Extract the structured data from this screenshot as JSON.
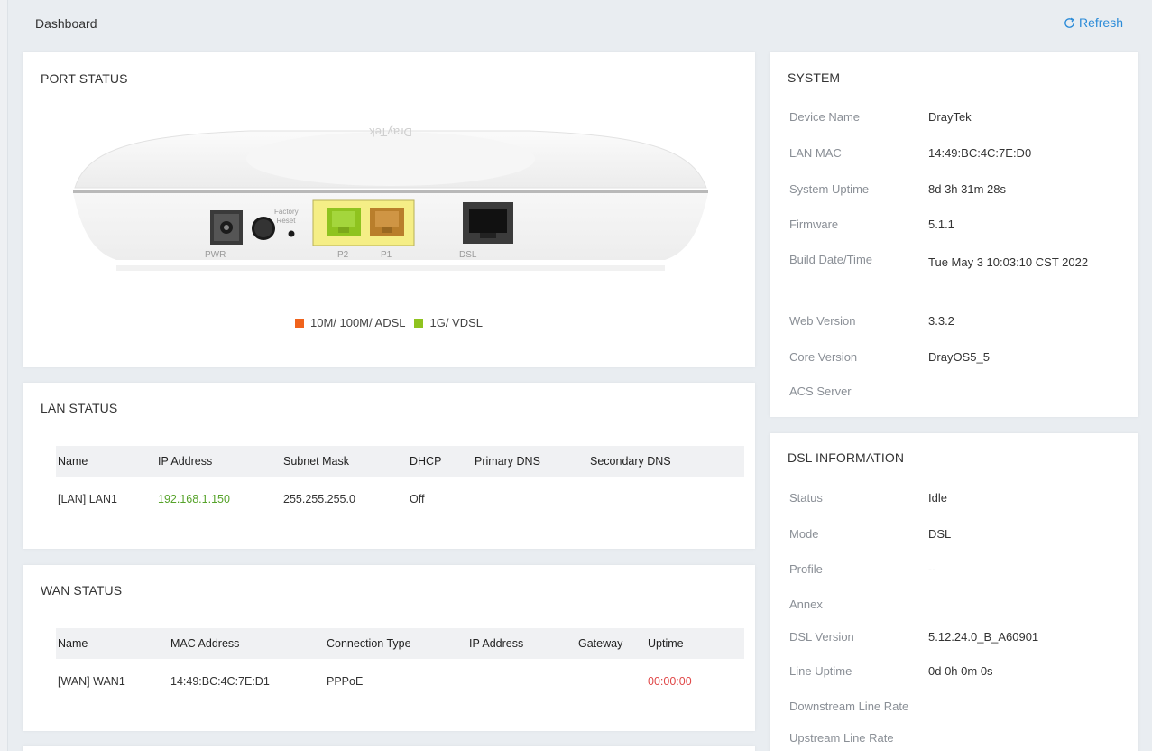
{
  "header": {
    "title": "Dashboard",
    "refresh_label": "Refresh"
  },
  "colors": {
    "accent": "#2b8bd8",
    "port_10m": "#f0631c",
    "port_1g": "#8fc31f",
    "ip_green": "#56a32a",
    "uptime_red": "#e04848",
    "port_highlight": "#f5ee86"
  },
  "port_status": {
    "title": "PORT STATUS",
    "device_brand": "DrayTek",
    "port_labels": {
      "pwr": "PWR",
      "factory_reset": "Factory Reset",
      "p2": "P2",
      "p1": "P1",
      "dsl": "DSL"
    },
    "legend": [
      {
        "label": "10M/ 100M/ ADSL",
        "color": "#f0631c"
      },
      {
        "label": "1G/ VDSL",
        "color": "#8fc31f"
      }
    ]
  },
  "lan_status": {
    "title": "LAN STATUS",
    "columns": [
      "Name",
      "IP Address",
      "Subnet Mask",
      "DHCP",
      "Primary DNS",
      "Secondary DNS"
    ],
    "rows": [
      {
        "name": "[LAN] LAN1",
        "ip": "192.168.1.150",
        "mask": "255.255.255.0",
        "dhcp": "Off",
        "primary_dns": "",
        "secondary_dns": ""
      }
    ]
  },
  "wan_status": {
    "title": "WAN STATUS",
    "columns": [
      "Name",
      "MAC Address",
      "Connection Type",
      "IP Address",
      "Gateway",
      "Uptime"
    ],
    "rows": [
      {
        "name": "[WAN] WAN1",
        "mac": "14:49:BC:4C:7E:D1",
        "type": "PPPoE",
        "ip": "",
        "gateway": "",
        "uptime": "00:00:00"
      }
    ]
  },
  "system": {
    "title": "SYSTEM",
    "fields": [
      {
        "label": "Device Name",
        "value": "DrayTek"
      },
      {
        "label": "LAN MAC",
        "value": "14:49:BC:4C:7E:D0"
      },
      {
        "label": "System Uptime",
        "value": "8d 3h 31m 28s"
      },
      {
        "label": "Firmware",
        "value": "5.1.1"
      },
      {
        "label": "Build Date/Time",
        "value": "Tue May 3 10:03:10 CST 2022"
      },
      {
        "label": "Web Version",
        "value": "3.3.2"
      },
      {
        "label": "Core Version",
        "value": "DrayOS5_5"
      },
      {
        "label": "ACS Server",
        "value": ""
      }
    ]
  },
  "dsl": {
    "title": "DSL INFORMATION",
    "fields": [
      {
        "label": "Status",
        "value": "Idle"
      },
      {
        "label": "Mode",
        "value": "DSL"
      },
      {
        "label": "Profile",
        "value": "--"
      },
      {
        "label": "Annex",
        "value": ""
      },
      {
        "label": "DSL Version",
        "value": "5.12.24.0_B_A60901"
      },
      {
        "label": "Line Uptime",
        "value": "0d 0h 0m 0s"
      },
      {
        "label": "Downstream Line Rate",
        "value": ""
      },
      {
        "label": "Upstream Line Rate",
        "value": ""
      }
    ]
  }
}
